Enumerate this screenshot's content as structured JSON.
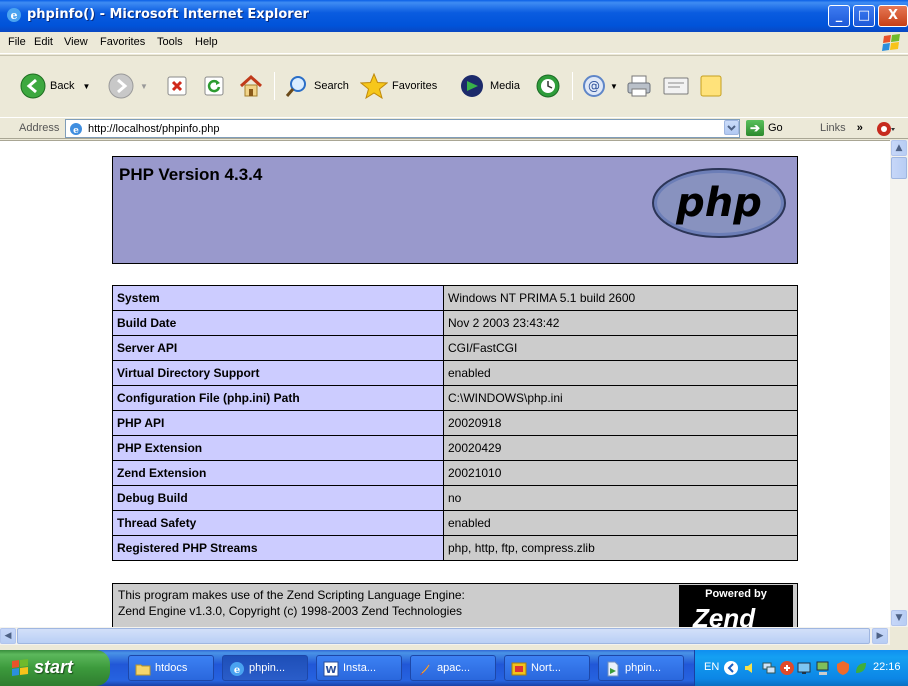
{
  "window": {
    "title": "phpinfo() - Microsoft Internet Explorer",
    "buttons": [
      "_",
      "□",
      "X"
    ]
  },
  "menu": [
    "File",
    "Edit",
    "View",
    "Favorites",
    "Tools",
    "Help"
  ],
  "toolbar": {
    "back": "Back",
    "search": "Search",
    "favorites": "Favorites",
    "media": "Media"
  },
  "address": {
    "label": "Address",
    "url": "http://localhost/phpinfo.php",
    "go": "Go",
    "links": "Links"
  },
  "php": {
    "version_title": "PHP Version 4.3.4",
    "logo_text": "php",
    "info_rows": [
      {
        "key": "System",
        "value": "Windows NT PRIMA 5.1 build 2600"
      },
      {
        "key": "Build Date",
        "value": "Nov 2 2003 23:43:42"
      },
      {
        "key": "Server API",
        "value": "CGI/FastCGI"
      },
      {
        "key": "Virtual Directory Support",
        "value": "enabled"
      },
      {
        "key": "Configuration File (php.ini) Path",
        "value": "C:\\WINDOWS\\php.ini"
      },
      {
        "key": "PHP API",
        "value": "20020918"
      },
      {
        "key": "PHP Extension",
        "value": "20020429"
      },
      {
        "key": "Zend Extension",
        "value": "20021010"
      },
      {
        "key": "Debug Build",
        "value": "no"
      },
      {
        "key": "Thread Safety",
        "value": "enabled"
      },
      {
        "key": "Registered PHP Streams",
        "value": "php, http, ftp, compress.zlib"
      }
    ],
    "zend_line1": "This program makes use of the Zend Scripting Language Engine:",
    "zend_line2": "Zend Engine v1.3.0, Copyright (c) 1998-2003 Zend Technologies",
    "zend_logo_top": "Powered by",
    "zend_logo_text": "Zend"
  },
  "taskbar": {
    "start": "start",
    "tasks": [
      "htdocs",
      "phpin...",
      "Insta...",
      "apac...",
      "Nort...",
      "phpin..."
    ],
    "lang": "EN",
    "clock": "22:16"
  },
  "colors": {
    "php_header": "#9999cc",
    "key_cell": "#ccccff",
    "value_cell": "#cccccc",
    "titlebar": "#0053d9",
    "taskbar": "#2157d7",
    "start": "#3c9a3c"
  }
}
